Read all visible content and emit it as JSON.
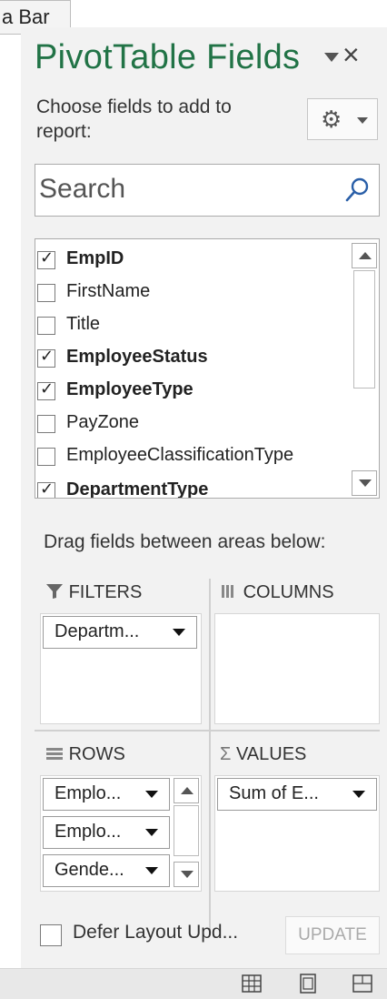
{
  "tooltip": {
    "text": "a Bar"
  },
  "header": {
    "title": "PivotTable Fields",
    "instructions": "Choose fields to add to report:",
    "title_color": "#217346"
  },
  "search": {
    "placeholder": "Search"
  },
  "fields": [
    {
      "label": "EmpID",
      "checked": true
    },
    {
      "label": "FirstName",
      "checked": false
    },
    {
      "label": "Title",
      "checked": false
    },
    {
      "label": "EmployeeStatus",
      "checked": true
    },
    {
      "label": "EmployeeType",
      "checked": true
    },
    {
      "label": "PayZone",
      "checked": false
    },
    {
      "label": "EmployeeClassificationType",
      "checked": false
    },
    {
      "label": "DepartmentType",
      "checked": true
    }
  ],
  "areas": {
    "instructions": "Drag fields between areas below:",
    "filters": {
      "label": "FILTERS",
      "items": [
        "Departm..."
      ]
    },
    "columns": {
      "label": "COLUMNS",
      "items": []
    },
    "rows": {
      "label": "ROWS",
      "items": [
        "Emplo...",
        "Emplo...",
        "Gende..."
      ]
    },
    "values": {
      "label": "VALUES",
      "items": [
        "Sum of E..."
      ]
    }
  },
  "footer": {
    "defer_label": "Defer Layout Upd...",
    "defer_checked": false,
    "update_label": "UPDATE"
  },
  "icons": {
    "close": "close-icon",
    "gear": "gear-icon",
    "search": "search-icon",
    "filter": "filter-icon",
    "columns": "columns-icon",
    "rows": "rows-icon",
    "values": "sigma-icon"
  }
}
